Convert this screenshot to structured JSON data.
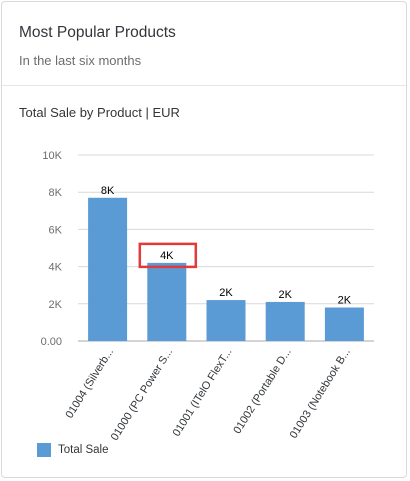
{
  "card": {
    "title": "Most Popular Products",
    "subtitle": "In the last six months"
  },
  "chart_data": {
    "type": "bar",
    "title": "Total Sale by Product | EUR",
    "xlabel": "",
    "ylabel": "",
    "ylim": [
      0,
      10000
    ],
    "y_ticks": [
      {
        "value": 0,
        "label": "0.00"
      },
      {
        "value": 2000,
        "label": "2K"
      },
      {
        "value": 4000,
        "label": "4K"
      },
      {
        "value": 6000,
        "label": "6K"
      },
      {
        "value": 8000,
        "label": "8K"
      },
      {
        "value": 10000,
        "label": "10K"
      }
    ],
    "categories": [
      "01004 (Silverb...",
      "01000 (PC Power S...",
      "01001 (ITelO FlexT...",
      "01002 (Portable D...",
      "01003 (Notebook B..."
    ],
    "series": [
      {
        "name": "Total Sale",
        "color": "#5b9bd5",
        "values": [
          7700,
          4200,
          2200,
          2100,
          1800
        ],
        "data_labels": [
          "8K",
          "4K",
          "2K",
          "2K",
          "2K"
        ]
      }
    ],
    "grid": true,
    "legend": "bottom-left",
    "highlighted_label_index": 1,
    "highlight_color": "#e03a3a"
  }
}
